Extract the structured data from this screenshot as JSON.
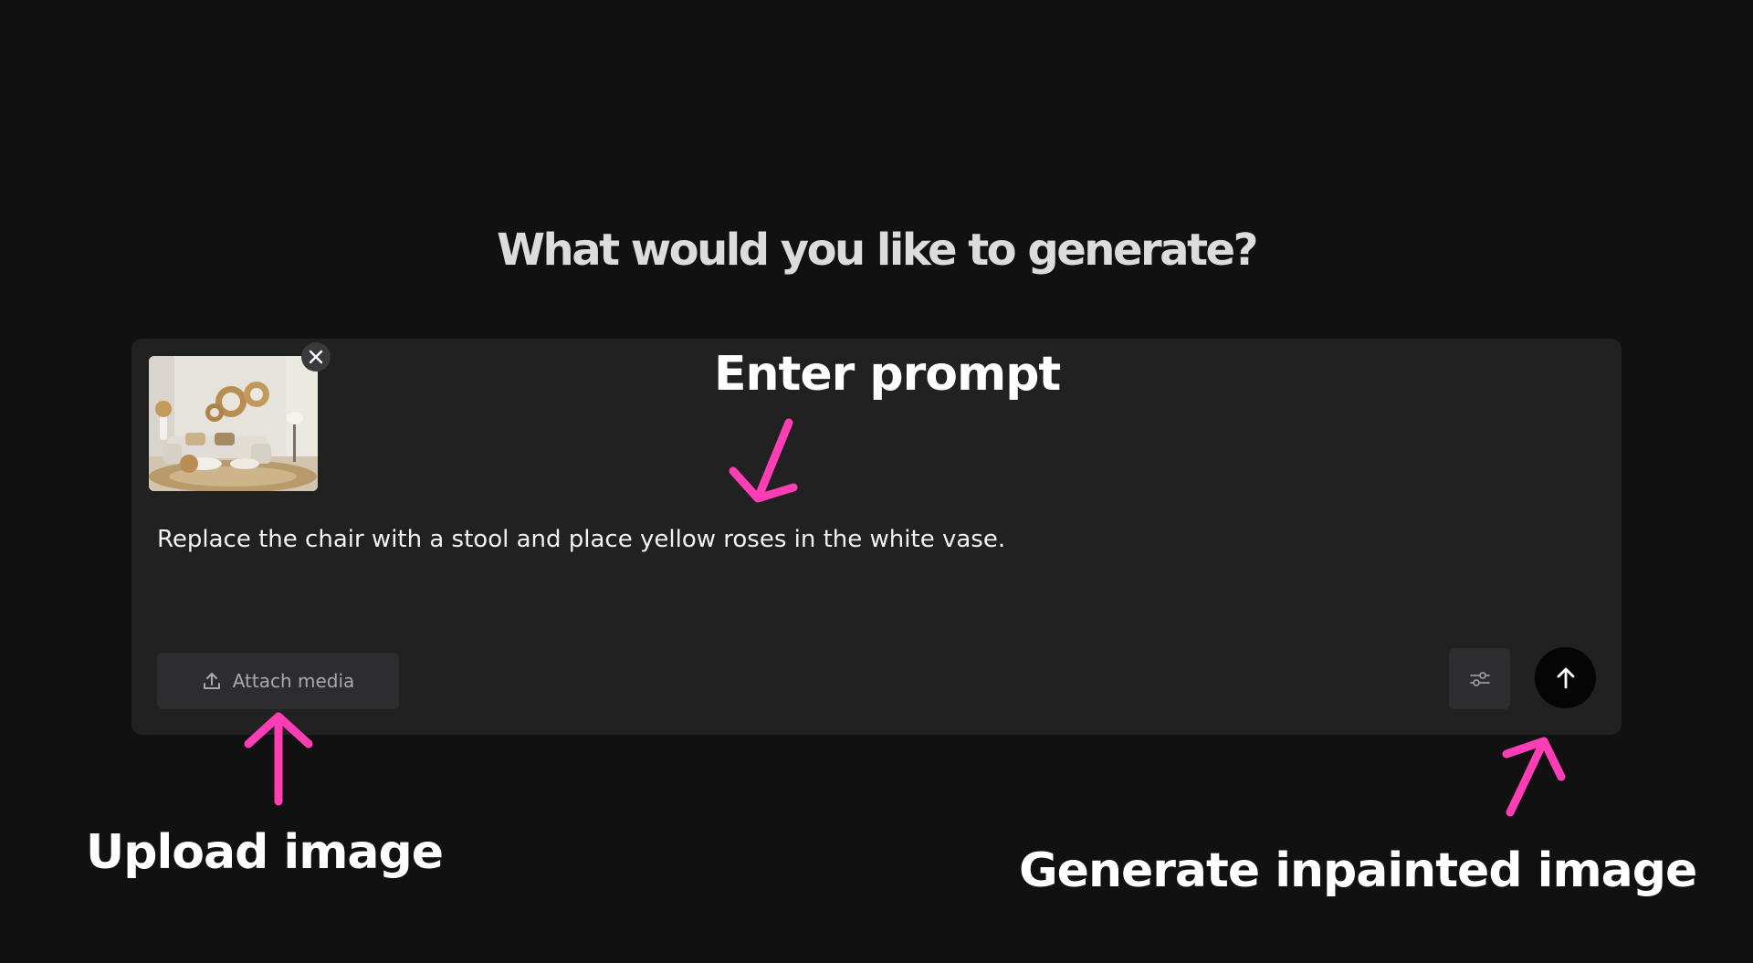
{
  "heading": "What would you like to generate?",
  "prompt_text": "Replace the chair with a stool and place yellow roses in the white vase.",
  "attached_image": {
    "alt": "living room"
  },
  "toolbar": {
    "attach_label": "Attach media"
  },
  "annotations": {
    "enter_prompt": "Enter prompt",
    "upload_image": "Upload image",
    "generate": "Generate inpainted image"
  },
  "colors": {
    "background": "#111112",
    "panel": "#212122",
    "button": "#2d2d2f",
    "annotation_arrow": "#ff3db4"
  },
  "icons": {
    "remove": "close-icon",
    "attach": "upload-icon",
    "settings": "sliders-icon",
    "send": "arrow-up-icon"
  }
}
